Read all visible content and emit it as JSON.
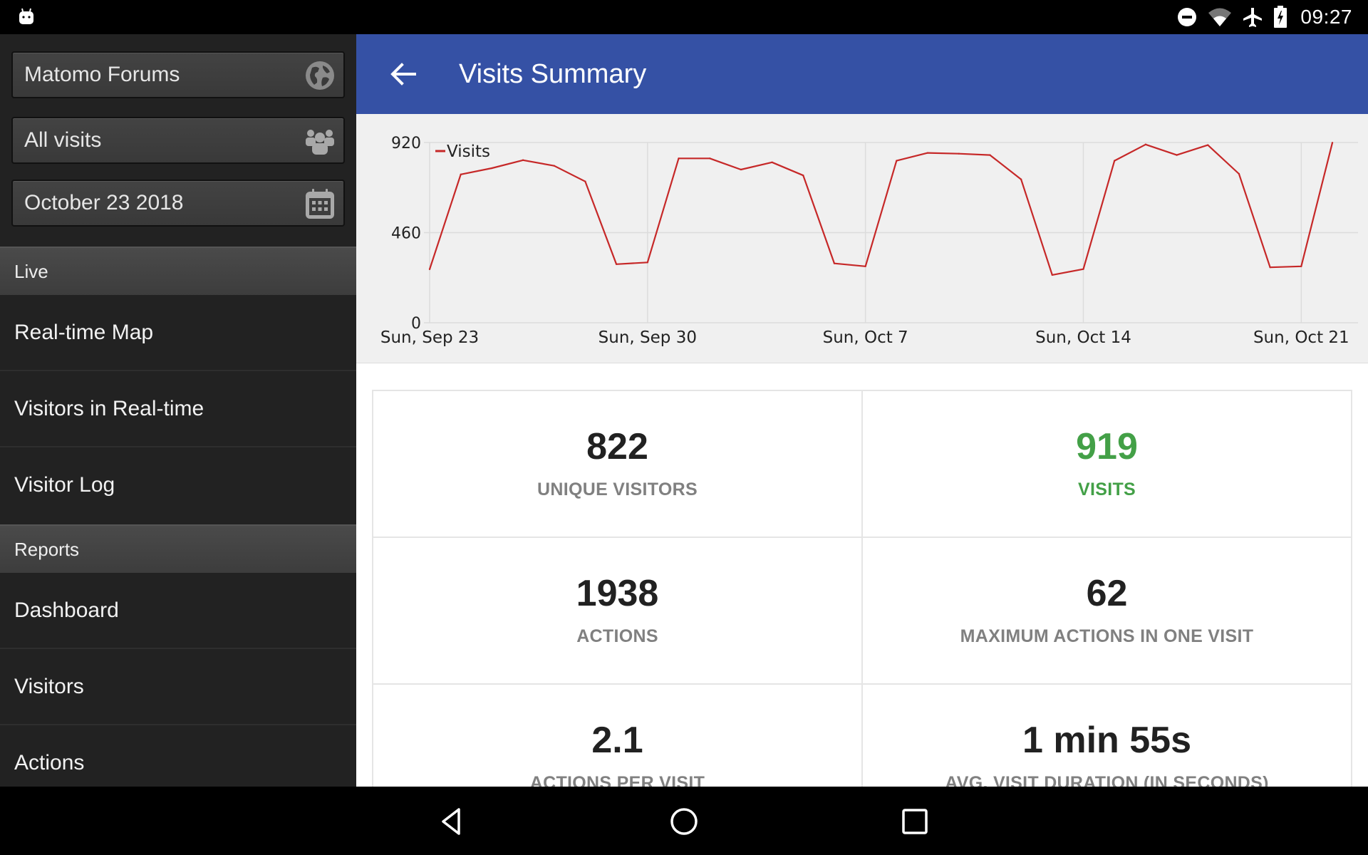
{
  "status_bar": {
    "left_icon": "android-debug-icon",
    "icons": [
      "do-not-disturb-icon",
      "wifi-icon",
      "airplane-mode-icon",
      "battery-charging-icon"
    ],
    "time": "09:27"
  },
  "sidebar": {
    "site_selector": {
      "value": "Matomo Forums",
      "icon": "globe-icon"
    },
    "segment_selector": {
      "value": "All visits",
      "icon": "users-icon"
    },
    "date_selector": {
      "value": "October 23 2018",
      "icon": "calendar-icon"
    },
    "sections": [
      {
        "header": "Live",
        "items": [
          "Real-time Map",
          "Visitors in Real-time",
          "Visitor Log"
        ]
      },
      {
        "header": "Reports",
        "items": [
          "Dashboard",
          "Visitors",
          "Actions"
        ]
      }
    ]
  },
  "appbar": {
    "back_icon": "arrow-left-icon",
    "title": "Visits Summary"
  },
  "chart_data": {
    "type": "line",
    "title": "",
    "xlabel": "",
    "ylabel": "",
    "ylim": [
      0,
      920
    ],
    "yticks": [
      "0",
      "460",
      "920"
    ],
    "xticks": [
      "Sun, Sep 23",
      "Sun, Sep 30",
      "Sun, Oct 7",
      "Sun, Oct 14",
      "Sun, Oct 21"
    ],
    "grid": true,
    "legend": "top-left",
    "x": [
      "Sep 23",
      "Sep 24",
      "Sep 25",
      "Sep 26",
      "Sep 27",
      "Sep 28",
      "Sep 29",
      "Sep 30",
      "Oct 1",
      "Oct 2",
      "Oct 3",
      "Oct 4",
      "Oct 5",
      "Oct 6",
      "Oct 7",
      "Oct 8",
      "Oct 9",
      "Oct 10",
      "Oct 11",
      "Oct 12",
      "Oct 13",
      "Oct 14",
      "Oct 15",
      "Oct 16",
      "Oct 17",
      "Oct 18",
      "Oct 19",
      "Oct 20",
      "Oct 21",
      "Oct 22"
    ],
    "series": [
      {
        "name": "Visits",
        "color": "#c62828",
        "values": [
          273,
          757,
          789,
          830,
          801,
          721,
          299,
          308,
          839,
          839,
          782,
          819,
          752,
          303,
          288,
          827,
          867,
          863,
          856,
          732,
          244,
          274,
          827,
          910,
          856,
          907,
          760,
          283,
          288,
          919
        ]
      }
    ]
  },
  "stats": [
    {
      "value": "822",
      "label": "UNIQUE VISITORS",
      "accent": false
    },
    {
      "value": "919",
      "label": "VISITS",
      "accent": true
    },
    {
      "value": "1938",
      "label": "ACTIONS",
      "accent": false
    },
    {
      "value": "62",
      "label": "MAXIMUM ACTIONS IN ONE VISIT",
      "accent": false
    },
    {
      "value": "2.1",
      "label": "ACTIONS PER VISIT",
      "accent": false
    },
    {
      "value": "1 min 55s",
      "label": "AVG. VISIT DURATION (IN SECONDS)",
      "accent": false
    }
  ],
  "colors": {
    "appbar": "#3551a5",
    "accent_green": "#43a047",
    "series_red": "#c62828"
  },
  "nav_bar": {
    "buttons": [
      "back-icon",
      "home-icon",
      "recents-icon"
    ]
  }
}
